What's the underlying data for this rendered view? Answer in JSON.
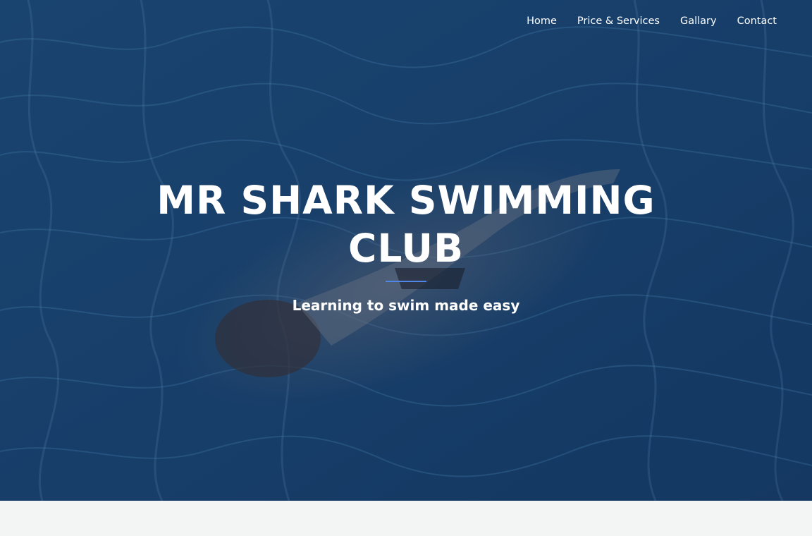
{
  "nav": {
    "items": [
      {
        "label": "Home"
      },
      {
        "label": "Price & Services"
      },
      {
        "label": "Gallary"
      },
      {
        "label": "Contact"
      }
    ]
  },
  "hero": {
    "title": "MR SHARK SWIMMING CLUB",
    "subtitle": "Learning to swim made easy",
    "divider_color": "#4f86e8",
    "overlay_color": "#173a62"
  },
  "page": {
    "below_fold_color": "#f3f4f4"
  }
}
